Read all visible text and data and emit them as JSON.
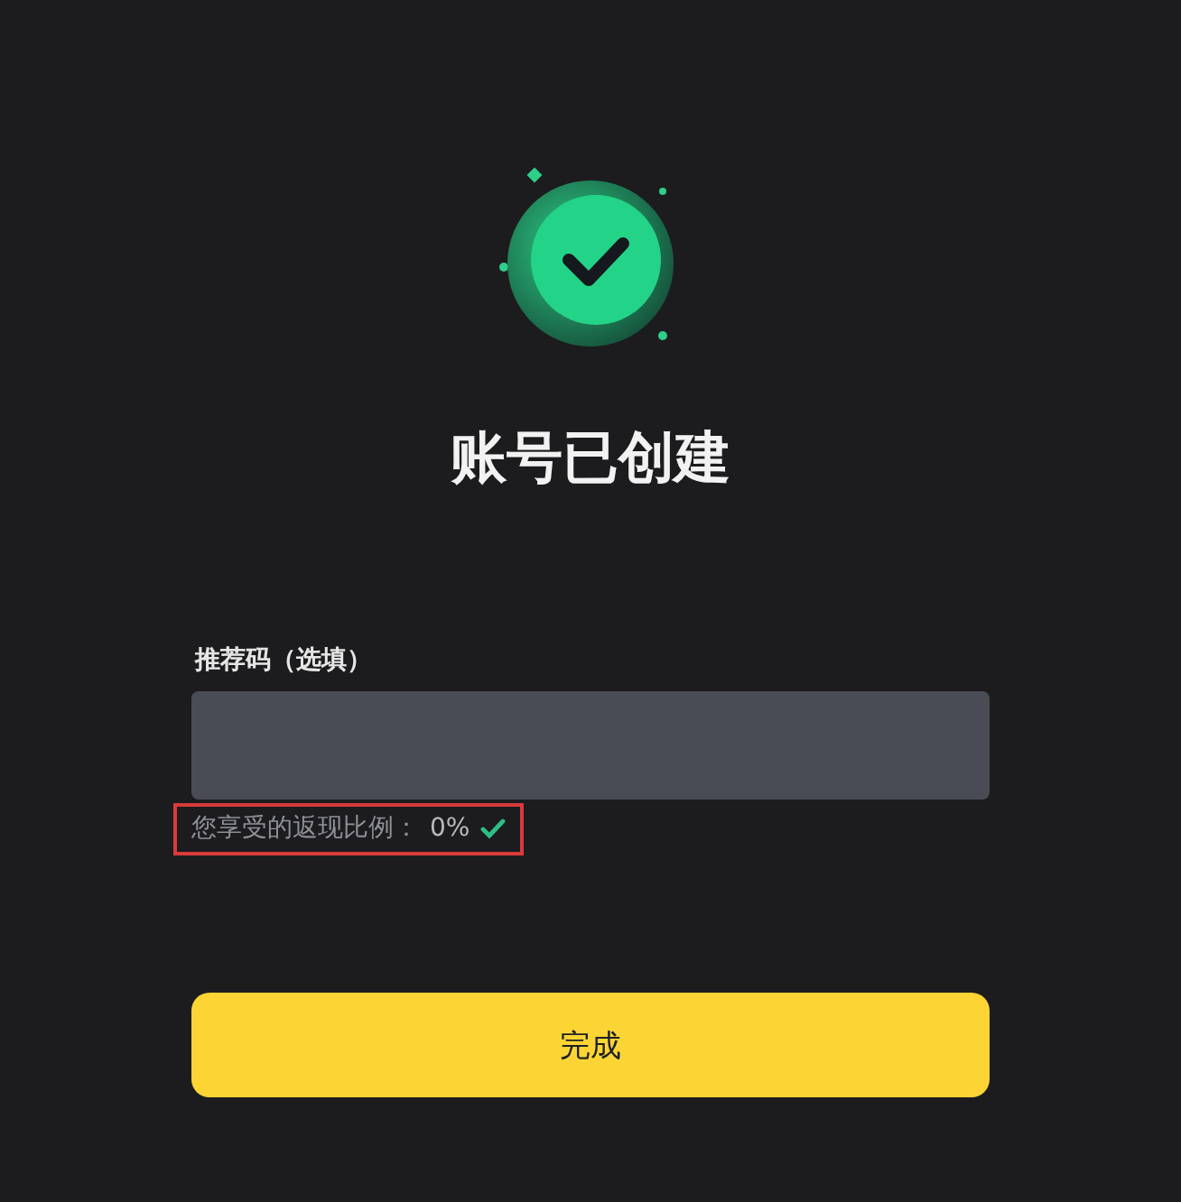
{
  "title": "账号已创建",
  "referral": {
    "label": "推荐码（选填）"
  },
  "rebate": {
    "label": "您享受的返现比例：",
    "value": "0%",
    "verified": true,
    "highlighted": true
  },
  "done_button": "完成"
}
